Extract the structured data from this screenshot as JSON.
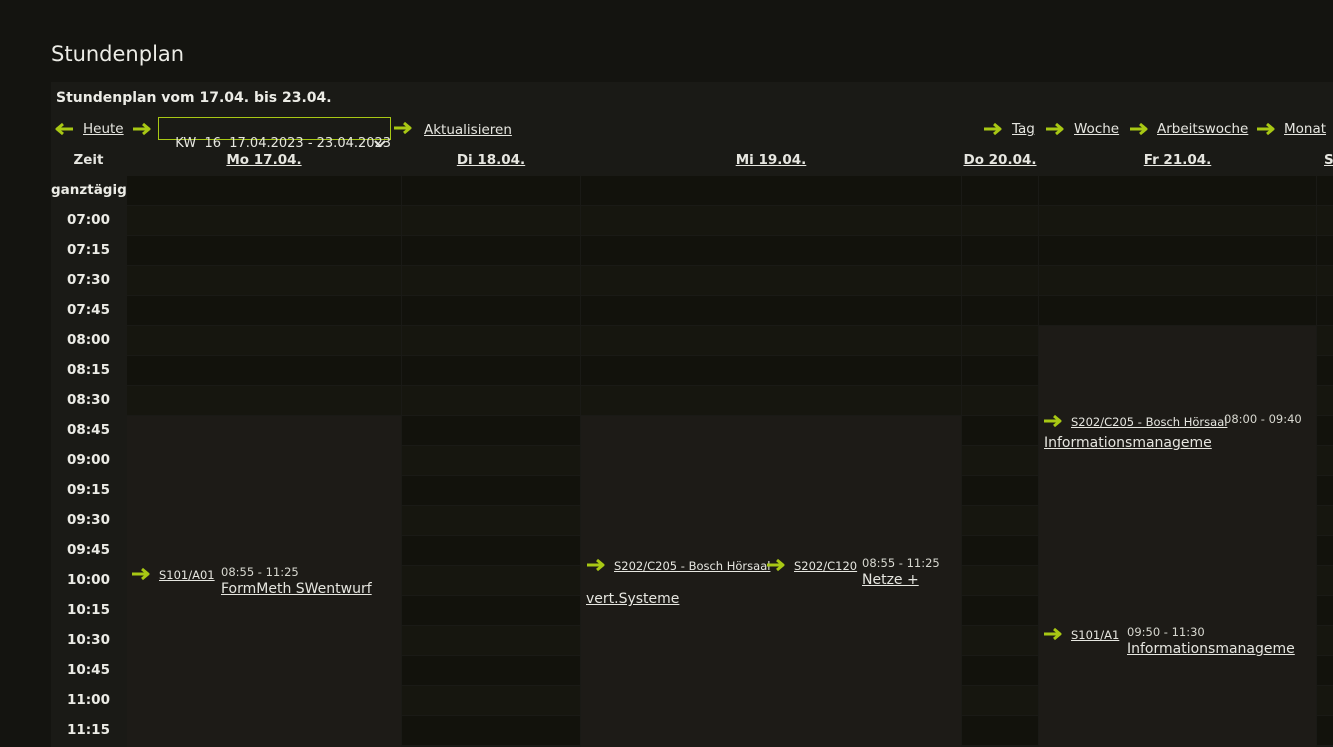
{
  "page": {
    "title": "Stundenplan",
    "subtitle": "Stundenplan vom 17.04. bis 23.04."
  },
  "nav": {
    "today_label": "Heute",
    "week_select_value": "KW  16  17.04.2023 - 23.04.2023",
    "refresh_label": "Aktualisieren",
    "view_day": "Tag",
    "view_week": "Woche",
    "view_workweek": "Arbeitswoche",
    "view_month": "Monat"
  },
  "colors": {
    "accent_arrow": "#a8c814",
    "background": "#141410",
    "event_background": "#1d1b17"
  },
  "icons": {
    "back": "arrow-left-icon",
    "forward": "arrow-right-icon",
    "dropdown": "chevron-down-icon"
  },
  "table": {
    "time_header": "Zeit",
    "allday_label": "ganztägig",
    "days": [
      {
        "label": "Mo 17.04."
      },
      {
        "label": "Di 18.04."
      },
      {
        "label": "Mi 19.04."
      },
      {
        "label": "Do 20.04."
      },
      {
        "label": "Fr 21.04."
      },
      {
        "label": "Sa"
      }
    ],
    "times": [
      "07:00",
      "07:15",
      "07:30",
      "07:45",
      "08:00",
      "08:15",
      "08:30",
      "08:45",
      "09:00",
      "09:15",
      "09:30",
      "09:45",
      "10:00",
      "10:15",
      "10:30",
      "10:45",
      "11:00",
      "11:15"
    ]
  },
  "events": {
    "mo": {
      "room": "S101/A01",
      "time": "08:55 - 11:25",
      "title": "FormMeth SWentwurf"
    },
    "mi_a": {
      "room": "S202/C205 - Bosch Hörsaal",
      "title": "vert.Systeme"
    },
    "mi_b": {
      "room": "S202/C120",
      "time": "08:55 - 11:25",
      "title": "Netze +"
    },
    "fr_a": {
      "room": "S202/C205 - Bosch Hörsaal",
      "time": "08:00 - 09:40",
      "title": "Informationsmanageme"
    },
    "fr_b": {
      "room": "S101/A1",
      "time": "09:50 - 11:30",
      "title": "Informationsmanageme"
    }
  }
}
